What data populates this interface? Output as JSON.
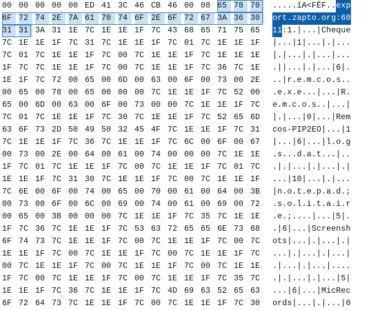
{
  "hex_rows": [
    "00 00 00 00 00 ED 41 3C 46 CB 46 00 08 65 78 70",
    "6F 72 74 2E 7A 61 70 74 6F 2E 6F 72 67 3A 36 30",
    "31 31 3A 31 1E 7C 1E 1E 1F 7C 43 68 65 71 75 65",
    "7C 1E 1E 1F 7C 31 7C 1E 1E 1F 7C 01 7C 1E 1E 1F",
    "7C 01 7C 1E 1E 1F 7C 00 7C 1E 1E 1F 7C 1E 1E 1E",
    "1F 7C 7C 1E 1E 1F 7C 00 7C 1E 1E 1F 7C 36 7C 1E",
    "1E 1F 7C 72 00 65 00 6D 00 63 00 6F 00 73 00 2E",
    "00 65 00 78 00 65 00 00 00 7C 1E 1E 1F 7C 52 00",
    "65 00 6D 00 63 00 6F 00 73 00 00 7C 1E 1E 1F 7C",
    "7C 01 7C 1E 1E 1F 7C 30 7C 1E 1E 1F 7C 52 65 6D",
    "63 6F 73 2D 50 49 50 32 45 4F 7C 1E 1E 1F 7C 31",
    "7C 1E 1E 1F 7C 36 7C 1E 1E 1F 7C 6C 00 6F 00 67",
    "00 73 00 2E 00 64 00 61 00 74 00 00 00 7C 1E 1E",
    "1F 7C 01 7C 1E 1E 1F 7C 00 7C 1E 1E 1F 7C 01 7C",
    "1E 1E 1F 7C 31 30 7C 1E 1E 1F 7C 00 7C 1E 1E 1F",
    "7C 6E 00 6F 00 74 00 65 00 70 00 61 00 64 00 3B",
    "00 73 00 6F 00 6C 00 69 00 74 00 61 00 69 00 72",
    "00 65 00 3B 00 00 00 7C 1E 1E 1F 7C 35 7C 1E 1E",
    "1F 7C 36 7C 1E 1E 1F 7C 53 63 72 65 65 6E 73 68",
    "6F 74 73 7C 1E 1E 1F 7C 00 7C 1E 1E 1F 7C 00 7C",
    "1E 1E 1F 7C 00 7C 1E 1E 1F 7C 00 7C 1E 1E 1F 7C",
    "00 7C 1E 1E 1F 7C 00 7C 1E 1E 1F 7C 00 7C 1E 1E",
    "1F 7C 00 7C 1E 1E 1F 7C 00 7C 1E 1E 1F 7C 35 7C",
    "1E 1E 1F 7C 36 7C 1E 1E 1F 7C 4D 69 63 52 65 63",
    "6F 72 64 73 7C 1E 1E 1F 7C 00 7C 1E 1E 1F 7C 30"
  ],
  "ascii_rows": [
    ".....íA<FËF..exp",
    "ort.zapto.org:60",
    "11:1.|...|Cheque",
    "|...|1|...|.|...",
    "|.|...|.|...|...",
    ".||...|.|...|6|.",
    "..|r.e.m.c.o.s..",
    ".e.x.e...|...|R.",
    "e.m.c.o.s..|...|",
    "|.|...|0|...|Rem",
    "cos-PIP2EO|...|1",
    "|...|6|...|l.o.g",
    ".s...d.a.t...|..",
    ".|.|...|.|...|.|",
    "...|10|...|.|...",
    "|n.o.t.e.p.a.d.;",
    ".s.o.l.i.t.a.i.r",
    ".e.;....|...|5|.",
    ".|6|...|Screensh",
    "ots|...|.|...|.|",
    "...|.|...|.|...|",
    ".|...|.|...|....",
    ".|.|...|.|...|5|",
    "...|6|...|MicRec",
    "ords|...|.|...|0"
  ],
  "selection": {
    "highlight_color": "#c9e1f5",
    "highlight_border": "#3e7fc2",
    "ascii_highlight_color": "#0b5ea8"
  }
}
